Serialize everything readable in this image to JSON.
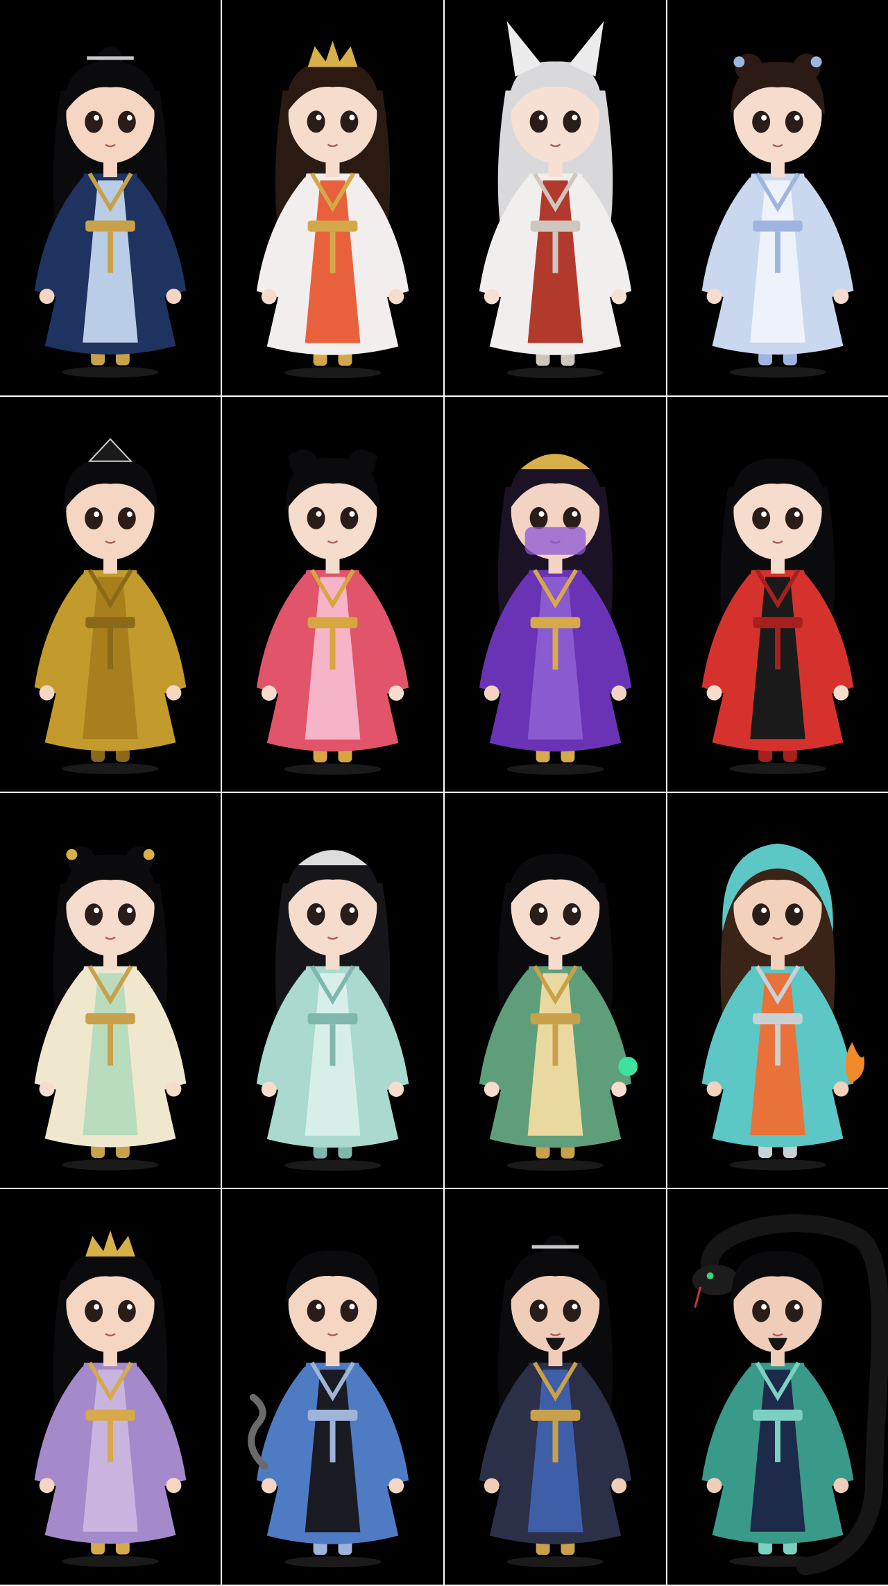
{
  "sheet": {
    "rows": 4,
    "columns": 4,
    "tile_background": "#000000",
    "separator_color": "#ffffff"
  },
  "figures": [
    {
      "row": 1,
      "col": 1,
      "subject": "male-scholar",
      "hair": "#0b0b0e",
      "main": "#1f3360",
      "second": "#b9cde6",
      "trim": "#c8a24a",
      "skin": "#f4d6c3",
      "accessory": "hairpin"
    },
    {
      "row": 1,
      "col": 2,
      "subject": "female-dancer",
      "hair": "#2a1a12",
      "main": "#f2eeee",
      "second": "#e8613c",
      "trim": "#d4a84a",
      "skin": "#f6dccd",
      "accessory": "golden-crown"
    },
    {
      "row": 1,
      "col": 3,
      "subject": "fox-eared-girl",
      "hair": "#d9d9dc",
      "main": "#f1efee",
      "second": "#b23a2c",
      "trim": "#cfc7be",
      "skin": "#f6e0d4",
      "accessory": "fox-ears"
    },
    {
      "row": 1,
      "col": 4,
      "subject": "twin-bun-girl",
      "hair": "#2b1b14",
      "main": "#c9d8ef",
      "second": "#eef3fb",
      "trim": "#9eb6df",
      "skin": "#f6dccd",
      "accessory": "blue-ribbons"
    },
    {
      "row": 2,
      "col": 1,
      "subject": "young-swordsman",
      "hair": "#0b0b0e",
      "main": "#c39a2c",
      "second": "#a97f1e",
      "trim": "#8a6a18",
      "skin": "#f4d6c3",
      "accessory": "black-crown"
    },
    {
      "row": 2,
      "col": 2,
      "subject": "red-pink-dancer",
      "hair": "#0b0b0e",
      "main": "#e2546a",
      "second": "#f6b4c8",
      "trim": "#d8a640",
      "skin": "#f6dccd",
      "accessory": "bun"
    },
    {
      "row": 2,
      "col": 3,
      "subject": "veiled-princess",
      "hair": "#1c1225",
      "main": "#6a33b5",
      "second": "#8a5ad0",
      "trim": "#d6a94a",
      "skin": "#f2d3c4",
      "accessory": "golden-tiara"
    },
    {
      "row": 2,
      "col": 4,
      "subject": "long-hair-girl-red",
      "hair": "#0b0b0e",
      "main": "#d6322d",
      "second": "#1a1a1a",
      "trim": "#a62020",
      "skin": "#f6dccd",
      "accessory": "none"
    },
    {
      "row": 3,
      "col": 1,
      "subject": "butterfly-bun-girl",
      "hair": "#0b0b0e",
      "main": "#efe8cf",
      "second": "#b9dcbc",
      "trim": "#c9a14a",
      "skin": "#f6dccd",
      "accessory": "gold-butterflies"
    },
    {
      "row": 3,
      "col": 2,
      "subject": "jade-robed-lady",
      "hair": "#16161a",
      "main": "#a9d9cf",
      "second": "#d8efe9",
      "trim": "#7fb7ad",
      "skin": "#f6dccd",
      "accessory": "silver-crown"
    },
    {
      "row": 3,
      "col": 3,
      "subject": "green-orb-sorceress",
      "hair": "#0b0b0e",
      "main": "#5f9e7a",
      "second": "#e9d9a0",
      "trim": "#c9a14a",
      "skin": "#f6dccd",
      "accessory": "green-orb"
    },
    {
      "row": 3,
      "col": 4,
      "subject": "hooded-fire-girl",
      "hair": "#3a2418",
      "main": "#5cc7c4",
      "second": "#e8723a",
      "trim": "#c8d2d6",
      "skin": "#f2d1bd",
      "accessory": "flame"
    },
    {
      "row": 4,
      "col": 1,
      "subject": "young-prince",
      "hair": "#0b0b0e",
      "main": "#a58acb",
      "second": "#c9b4e0",
      "trim": "#d6a94a",
      "skin": "#f4d6c3",
      "accessory": "gold-crown"
    },
    {
      "row": 4,
      "col": 2,
      "subject": "smoke-mage",
      "hair": "#0b0b0e",
      "main": "#4f7bc4",
      "second": "#1a1a22",
      "trim": "#9fb4d8",
      "skin": "#f4d6c3",
      "accessory": "smoke"
    },
    {
      "row": 4,
      "col": 3,
      "subject": "bearded-scholar",
      "hair": "#0b0b0e",
      "main": "#2b2f48",
      "second": "#3e5ea8",
      "trim": "#c9a14a",
      "skin": "#efcdb8",
      "accessory": "topknot-pin"
    },
    {
      "row": 4,
      "col": 4,
      "subject": "snake-sorcerer",
      "hair": "#0b0b0e",
      "main": "#3a9a8a",
      "second": "#1d2a4a",
      "trim": "#7cd0c2",
      "skin": "#efcdb8",
      "accessory": "black-serpent"
    }
  ]
}
